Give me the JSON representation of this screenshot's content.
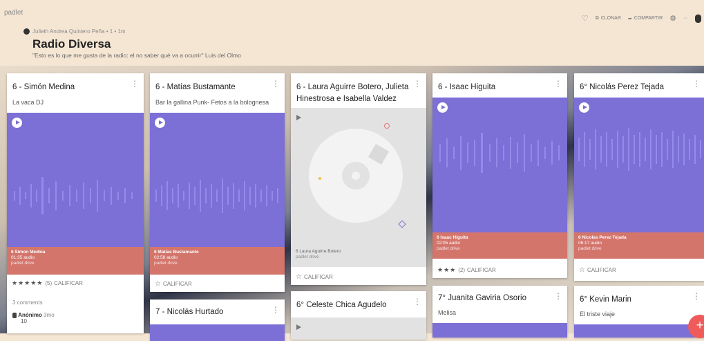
{
  "app": {
    "brand": "padlet"
  },
  "header": {
    "author_line": "Julieth Andrea Quintero Peña • 1 • 1m",
    "title": "Radio Diversa",
    "subtitle": "\"Esto es lo que me gusta de la radio: el no saber qué va a ocurrir\" Luis del Olmo"
  },
  "actions": {
    "clone": "CLONAR",
    "share": "COMPARTIR",
    "more": "···"
  },
  "cards": [
    {
      "title": "6 - Simón Medina",
      "desc": "La vaca DJ",
      "meta1": "6 Simon Medina",
      "meta2": "01:35 audio",
      "meta3": "padlet drive",
      "stars": "★★★★★",
      "count": "(5)",
      "rate": "CALIFICAR",
      "comments": "3 comments",
      "commenter": "Anónimo",
      "comment_time": "3mo",
      "comment_text": "10"
    },
    {
      "title": "6 - Matías Bustamante",
      "desc": "Bar la gallina Punk- Fetos a la bolognesa",
      "meta1": "6 Matías Bustamante",
      "meta2": "02:58 audio",
      "meta3": "padlet drive",
      "star": "☆",
      "rate": "CALIFICAR"
    },
    {
      "title": "6 - Laura Aguirre Botero, Julieta Hinestrosa e Isabella Valdez",
      "meta1": "6 Laura Aguirre Botero",
      "meta3": "padlet drive",
      "star": "☆",
      "rate": "CALIFICAR"
    },
    {
      "title": "6 - Isaac Higuita",
      "meta1": "6 Isaac Higuita",
      "meta2": "02:05 audio",
      "meta3": "padlet drive",
      "stars": "★★★",
      "count": "(2)",
      "rate": "CALIFICAR"
    },
    {
      "title": "6° Nicolás Perez Tejada",
      "meta1": "6 Nicolas Perez Tejada",
      "meta2": "06:17 audio",
      "meta3": "padlet drive",
      "star": "☆",
      "rate": "CALIFICAR"
    },
    {
      "title": "7 - Nicolás Hurtado"
    },
    {
      "title": "6° Celeste Chica Agudelo"
    },
    {
      "title": "7° Juanita Gaviria Osorio",
      "desc": "Melisa"
    },
    {
      "title": "6° Kevin Marin",
      "desc": "El triste viaje"
    }
  ],
  "fab": {
    "label": "+"
  },
  "colors": {
    "audio": "#7c6fd6",
    "meta": "#d4756c",
    "fab": "#ef5b5b"
  }
}
